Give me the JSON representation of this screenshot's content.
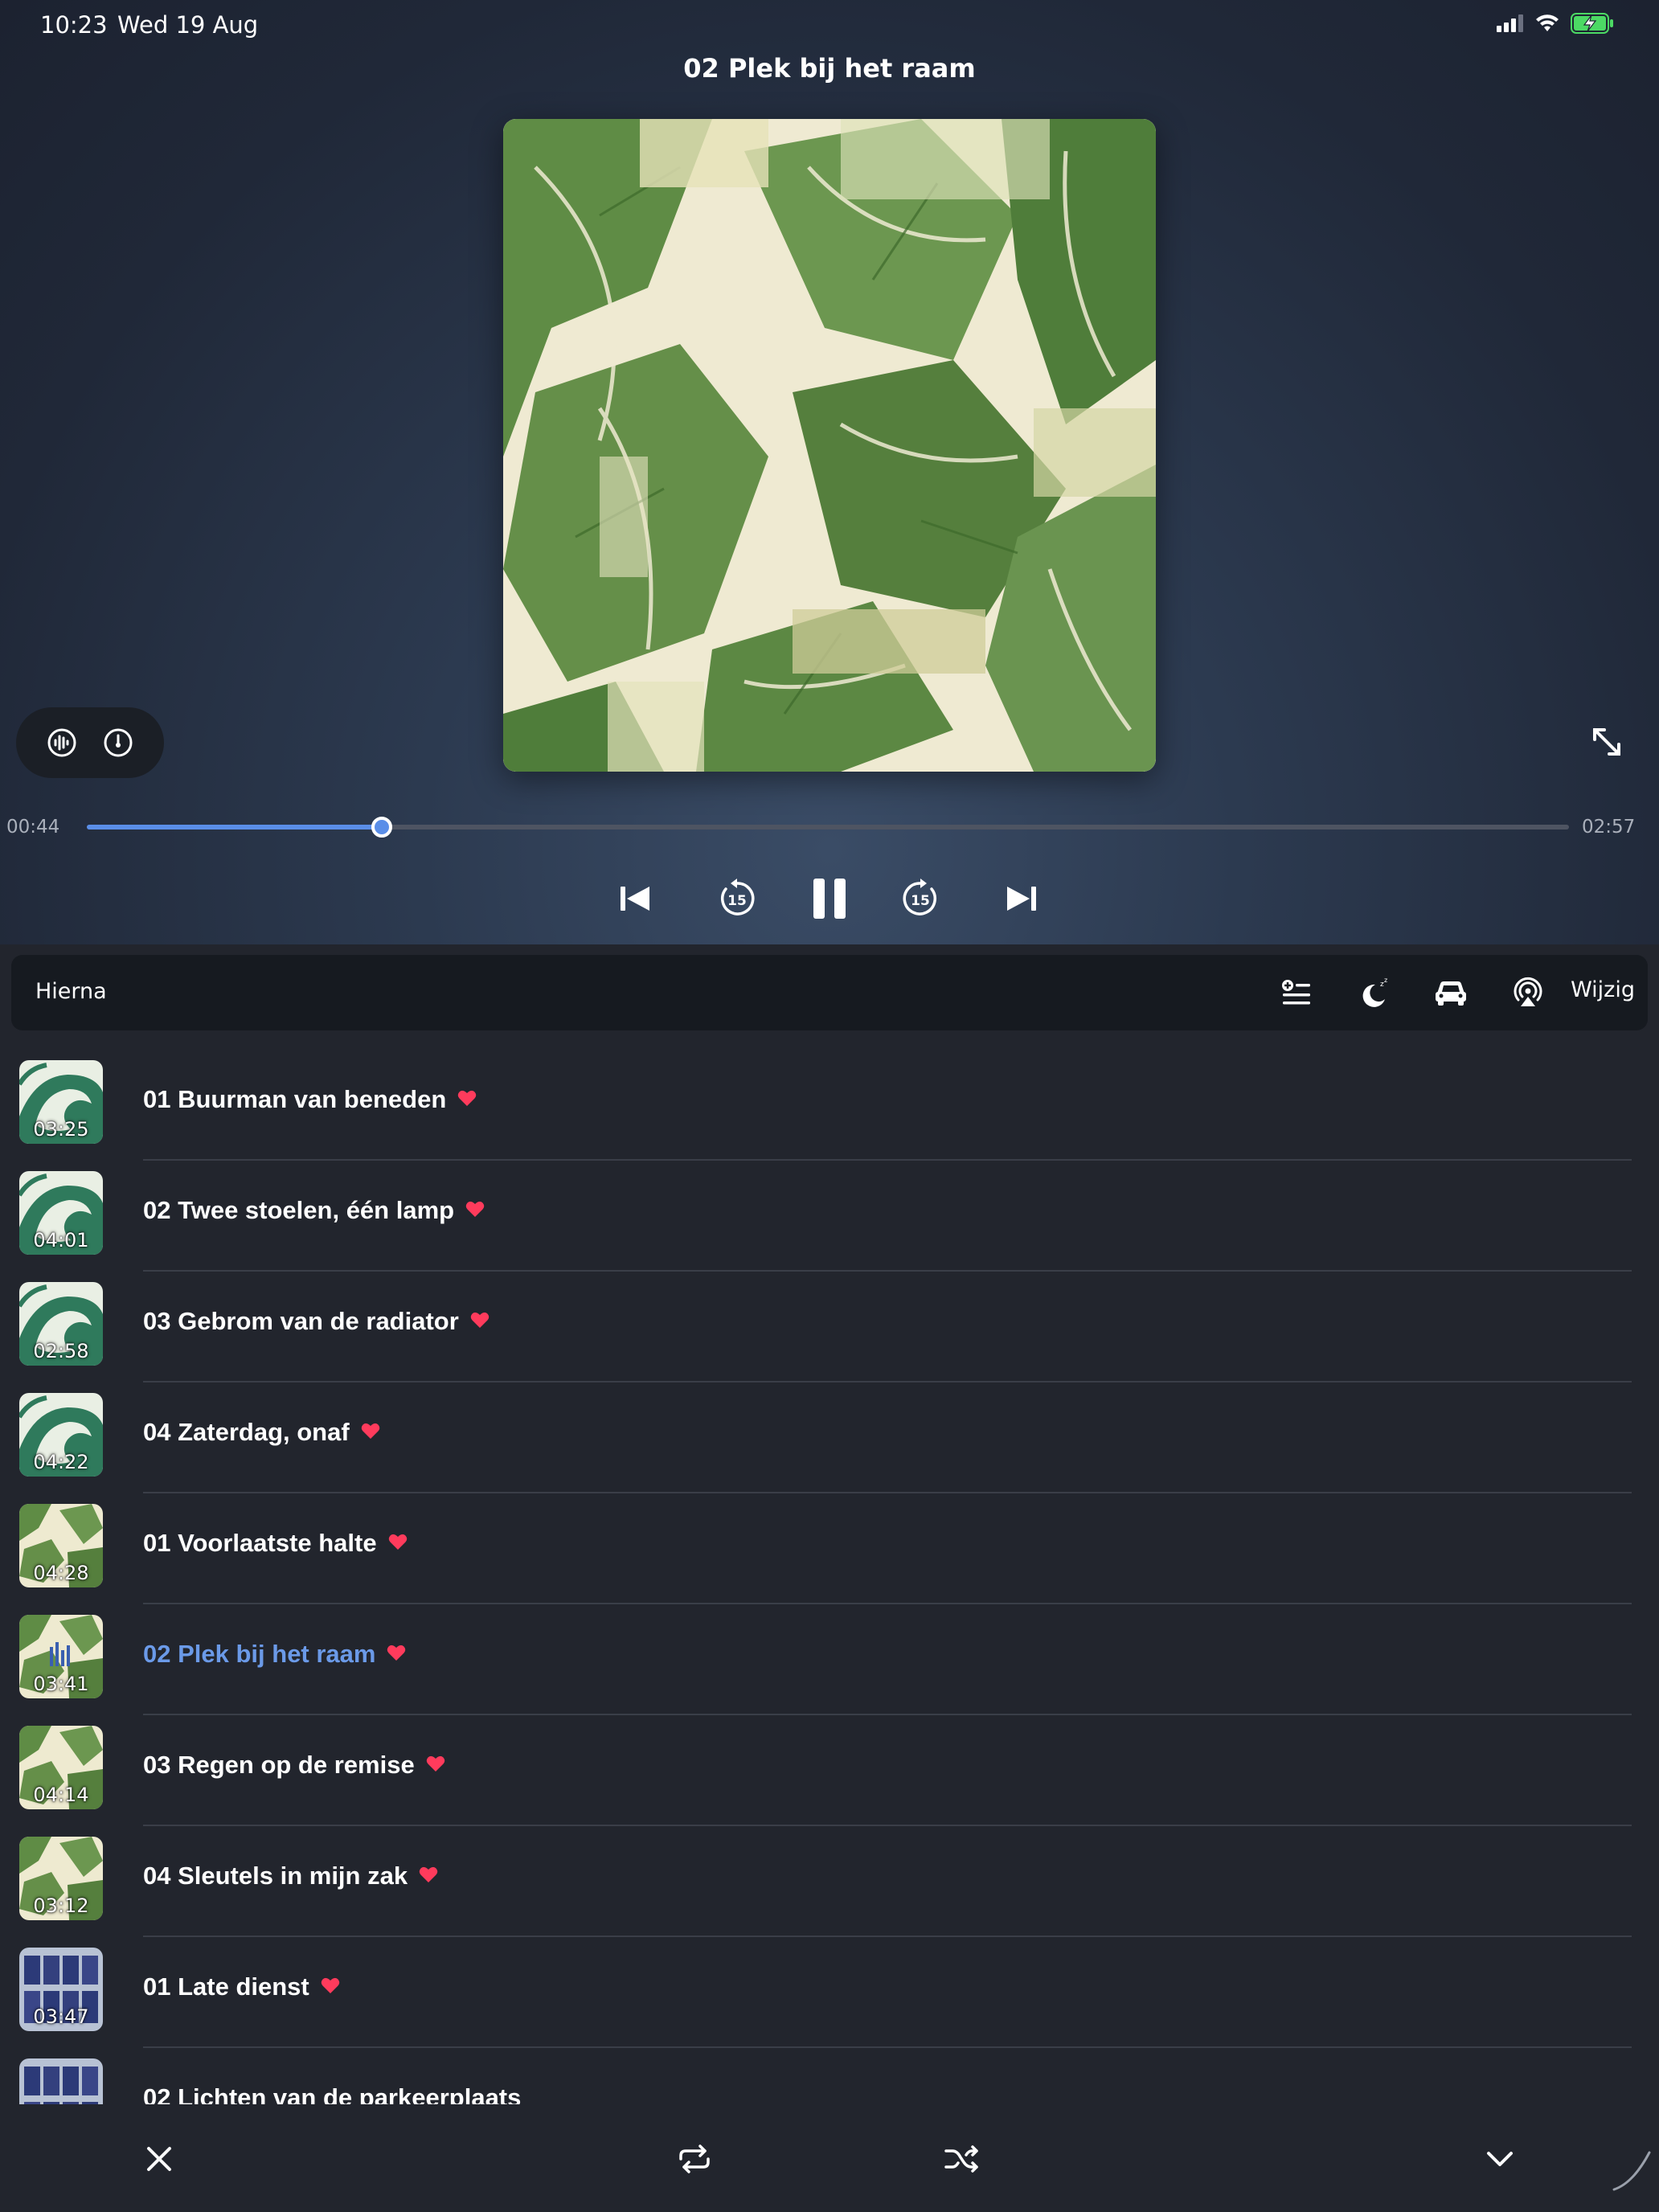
{
  "status": {
    "time": "10:23",
    "date": "Wed 19 Aug"
  },
  "now_playing": {
    "title": "02 Plek bij het raam",
    "elapsed": "00:44",
    "total": "02:57",
    "progress": 0.199
  },
  "queue": {
    "label": "Hierna",
    "edit_label": "Wijzig"
  },
  "tracks": [
    {
      "title": "01 Buurman van beneden",
      "duration": "03:25",
      "art": "wave",
      "current": false
    },
    {
      "title": "02 Twee stoelen, één lamp",
      "duration": "04:01",
      "art": "wave",
      "current": false
    },
    {
      "title": "03 Gebrom van de radiator",
      "duration": "02:58",
      "art": "wave",
      "current": false
    },
    {
      "title": "04 Zaterdag, onaf",
      "duration": "04:22",
      "art": "wave",
      "current": false
    },
    {
      "title": "01 Voorlaatste halte",
      "duration": "04:28",
      "art": "leaves",
      "current": false
    },
    {
      "title": "02 Plek bij het raam",
      "duration": "03:41",
      "art": "leaves",
      "current": true
    },
    {
      "title": "03 Regen op de remise",
      "duration": "04:14",
      "art": "leaves",
      "current": false
    },
    {
      "title": "04 Sleutels in mijn zak",
      "duration": "03:12",
      "art": "leaves",
      "current": false
    },
    {
      "title": "01 Late dienst",
      "duration": "03:47",
      "art": "building",
      "current": false
    },
    {
      "title": "02 Lichten van de parkeerplaats",
      "duration": "",
      "art": "building",
      "current": false
    }
  ],
  "colors": {
    "accent": "#5a8ee8",
    "current_track": "#6b9ae8",
    "heart": "#ff3b5c",
    "background": "#22252d",
    "battery": "#4cd964"
  },
  "icons": {
    "waveform": "waveform-icon",
    "speed": "speed-dial-icon",
    "expand": "expand-arrows-icon",
    "previous": "skip-previous-icon",
    "rewind": "rewind-15-icon",
    "pause": "pause-icon",
    "forward": "forward-15-icon",
    "next": "skip-next-icon",
    "add_to_queue": "add-list-icon",
    "sleep": "sleep-timer-icon",
    "car": "car-mode-icon",
    "airplay": "airplay-icon",
    "close": "close-icon",
    "repeat": "repeat-icon",
    "shuffle": "shuffle-icon",
    "collapse": "chevron-down-icon",
    "favorite": "heart-icon"
  }
}
